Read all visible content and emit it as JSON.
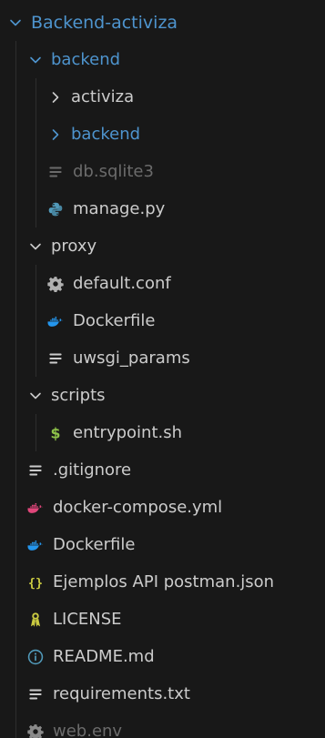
{
  "explorer": {
    "items": [
      {
        "label": "Backend-activiza",
        "kind": "folder",
        "state": "open",
        "depth": 0,
        "style": "root"
      },
      {
        "label": "backend",
        "kind": "folder",
        "state": "open",
        "depth": 1,
        "style": "blue"
      },
      {
        "label": "activiza",
        "kind": "folder",
        "state": "closed",
        "depth": 2,
        "style": "normal"
      },
      {
        "label": "backend",
        "kind": "folder",
        "state": "closed",
        "depth": 2,
        "style": "blue"
      },
      {
        "label": "db.sqlite3",
        "kind": "file",
        "icon": "lines-icon",
        "depth": 2,
        "style": "dim"
      },
      {
        "label": "manage.py",
        "kind": "file",
        "icon": "python-icon",
        "depth": 2,
        "style": "normal"
      },
      {
        "label": "proxy",
        "kind": "folder",
        "state": "open",
        "depth": 1,
        "style": "normal"
      },
      {
        "label": "default.conf",
        "kind": "file",
        "icon": "gear-icon",
        "depth": 2,
        "style": "normal"
      },
      {
        "label": "Dockerfile",
        "kind": "file",
        "icon": "docker-icon",
        "depth": 2,
        "style": "normal"
      },
      {
        "label": "uwsgi_params",
        "kind": "file",
        "icon": "lines-icon",
        "depth": 2,
        "style": "normal"
      },
      {
        "label": "scripts",
        "kind": "folder",
        "state": "open",
        "depth": 1,
        "style": "normal"
      },
      {
        "label": "entrypoint.sh",
        "kind": "file",
        "icon": "dollar-icon",
        "depth": 2,
        "style": "normal"
      },
      {
        "label": ".gitignore",
        "kind": "file",
        "icon": "lines-icon",
        "depth": 1,
        "style": "normal"
      },
      {
        "label": "docker-compose.yml",
        "kind": "file",
        "icon": "docker-pink-icon",
        "depth": 1,
        "style": "normal"
      },
      {
        "label": "Dockerfile",
        "kind": "file",
        "icon": "docker-icon",
        "depth": 1,
        "style": "normal"
      },
      {
        "label": "Ejemplos API postman.json",
        "kind": "file",
        "icon": "braces-icon",
        "depth": 1,
        "style": "normal"
      },
      {
        "label": "LICENSE",
        "kind": "file",
        "icon": "license-icon",
        "depth": 1,
        "style": "normal"
      },
      {
        "label": "README.md",
        "kind": "file",
        "icon": "info-icon",
        "depth": 1,
        "style": "normal"
      },
      {
        "label": "requirements.txt",
        "kind": "file",
        "icon": "lines-icon",
        "depth": 1,
        "style": "normal"
      },
      {
        "label": "web.env",
        "kind": "file",
        "icon": "gear-icon",
        "depth": 1,
        "style": "dim"
      }
    ]
  },
  "colors": {
    "background": "#181818",
    "text": "#cccccc",
    "accent_blue": "#4e94ce",
    "dim": "#6b6b6b",
    "python": "#519aba",
    "docker": "#2496ed",
    "docker_pink": "#e0467a",
    "shell": "#8dc149",
    "json": "#cbcb41",
    "license": "#cbcb41",
    "info": "#519aba"
  }
}
